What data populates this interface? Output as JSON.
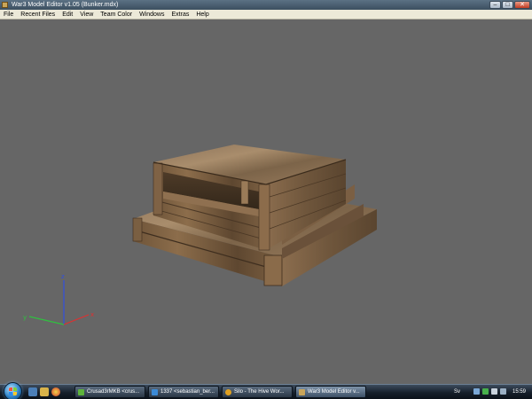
{
  "window": {
    "title": "War3 Model Editor v1.05 (Bunker.mdx)",
    "minimize": "–",
    "maximize": "□",
    "close": "✕"
  },
  "menu": [
    "File",
    "Recent Files",
    "Edit",
    "View",
    "Team Color",
    "Windows",
    "Extras",
    "Help"
  ],
  "viewport": {
    "background": "#666666",
    "axes": {
      "x": "x",
      "y": "y",
      "z": "z"
    },
    "axis_colors": {
      "x": "#e03030",
      "y": "#30c040",
      "z": "#3050e0"
    },
    "model_name": "Bunker.mdx"
  },
  "taskbar": {
    "tasks": [
      {
        "label": "Crusad3rMKB <crus...",
        "icon_color": "#5db33b",
        "active": false
      },
      {
        "label": "1337 <sebastian_ber...",
        "icon_color": "#3b8ad6",
        "active": false
      },
      {
        "label": "Silo - The Hive Wor...",
        "icon_color": "#e0a020",
        "active": false
      },
      {
        "label": "War3 Model Editor v...",
        "icon_color": "#c9a55a",
        "active": true
      }
    ],
    "language": "Sv",
    "clock": "15:59"
  }
}
